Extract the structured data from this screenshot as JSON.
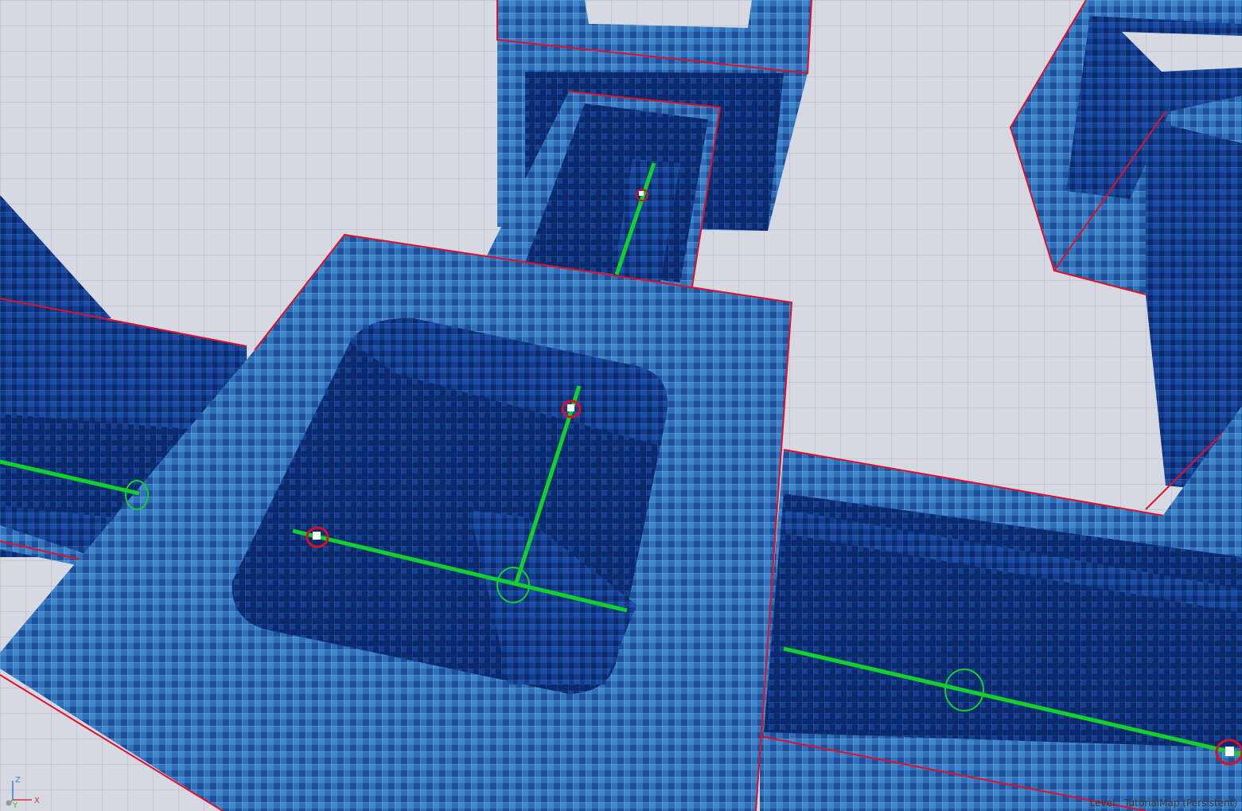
{
  "viewport": {
    "status": {
      "level_prefix": "Level:",
      "level_name": "TutorialMap (Persistent)"
    },
    "axes": {
      "z": "Z",
      "x": "X",
      "y": "Y"
    },
    "colors": {
      "floor": "#d6d8e2",
      "floor_grid": "#a9adbc",
      "tile_face": "#2f6fb8",
      "tile_dark": "#0d2f7a",
      "tile_shadow": "#0a2466",
      "edge_highlight": "#e0102a",
      "spline": "#12d12b",
      "gizmo_red": "#d81020"
    },
    "icons": [
      "spline-node-icon",
      "pivot-circle-icon",
      "axis-gizmo-icon"
    ]
  }
}
